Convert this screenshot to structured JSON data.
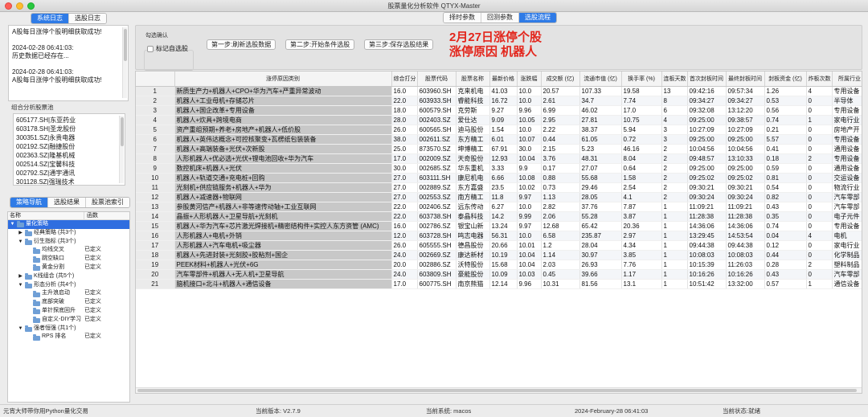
{
  "window": {
    "title": "股票量化分析软件 QTYX-Master"
  },
  "left": {
    "log_tabs": [
      "系统日志",
      "选股日志"
    ],
    "log_lines": [
      "A股每日涨停个股明细获取成功!",
      "",
      "2024-02-28 06:41:03:",
      "历史数据已经存在...",
      "",
      "2024-02-28 06:41:03:",
      "A股每日涨停个股明细获取成功!"
    ],
    "stock_pool_label": "组合分析股票池",
    "stocks": [
      "605177.SH|东亚药业",
      "603178.SH|圣龙股份",
      "300351.SZ|永贵电器",
      "002192.SZ|融捷股份",
      "002363.SZ|隆基机械",
      "002514.SZ|宝馨科技",
      "002792.SZ|通宇通讯",
      "301128.SZ|强瑞技术"
    ],
    "nav_tabs": [
      "策略导航",
      "选股结果",
      "股票池索引"
    ],
    "tree_headers": [
      "名称",
      "函数"
    ],
    "tree": [
      {
        "label": "量化策略",
        "fn": "",
        "level": 0,
        "tri": "▼",
        "folder": true,
        "sel": true
      },
      {
        "label": "经典策略 (共3个)",
        "fn": "",
        "level": 1,
        "tri": "▶",
        "folder": true
      },
      {
        "label": "衍生指标 (共3个)",
        "fn": "",
        "level": 1,
        "tri": "▼",
        "folder": true
      },
      {
        "label": "均线交叉",
        "fn": "已定义",
        "level": 2,
        "tri": "",
        "folder": true
      },
      {
        "label": "跳空缺口",
        "fn": "已定义",
        "level": 2,
        "tri": "",
        "folder": true
      },
      {
        "label": "黄金分割",
        "fn": "已定义",
        "level": 2,
        "tri": "",
        "folder": true
      },
      {
        "label": "K线组合 (共5个)",
        "fn": "",
        "level": 1,
        "tri": "▶",
        "folder": true
      },
      {
        "label": "形态分析 (共4个)",
        "fn": "",
        "level": 1,
        "tri": "▼",
        "folder": true
      },
      {
        "label": "主升浪启动",
        "fn": "已定义",
        "level": 2,
        "tri": "",
        "folder": true
      },
      {
        "label": "底部突破",
        "fn": "已定义",
        "level": 2,
        "tri": "",
        "folder": true
      },
      {
        "label": "单针探底回升",
        "fn": "已定义",
        "level": 2,
        "tri": "",
        "folder": true
      },
      {
        "label": "自定义-DIY学习",
        "fn": "已定义",
        "level": 2,
        "tri": "",
        "folder": true
      },
      {
        "label": "强者恒强 (共1个)",
        "fn": "",
        "level": 1,
        "tri": "▼",
        "folder": true
      },
      {
        "label": "RPS 排名",
        "fn": "已定义",
        "level": 2,
        "tri": "",
        "folder": true
      }
    ]
  },
  "right": {
    "tabs": [
      "择时参数",
      "回测参数",
      "选股流程"
    ],
    "group_label": "勾选确认",
    "checkbox_label": "标记自选股",
    "buttons": [
      "第一步:刷新选股数据",
      "第二步:开始条件选股",
      "第三步:保存选股结果"
    ],
    "banner_lines": [
      "2月27日涨停个股",
      "涨停原因 机器人"
    ],
    "columns": [
      "",
      "涨停原因类别",
      "综合打分",
      "股票代码",
      "股票名称",
      "最新价格",
      "涨跌幅",
      "成交额 (亿)",
      "流通市值 (亿)",
      "换手率 (%)",
      "连板天数",
      "首次封板时间",
      "最终封板时间",
      "封板资金 (亿)",
      "炸板次数",
      "所属行业"
    ],
    "rows": [
      [
        "1",
        "新质生产力+机器人+CPO+华为汽车+严重异常波动",
        "16.0",
        "603960.SH",
        "克来机电",
        "41.03",
        "10.0",
        "20.57",
        "107.33",
        "19.58",
        "13",
        "09:42:16",
        "09:57:34",
        "1.26",
        "4",
        "专用设备"
      ],
      [
        "2",
        "机器人+工业母机+存储芯片",
        "22.0",
        "603933.SH",
        "睿能科技",
        "16.72",
        "10.0",
        "2.61",
        "34.7",
        "7.74",
        "8",
        "09:34:27",
        "09:34:27",
        "0.53",
        "0",
        "半导体"
      ],
      [
        "3",
        "机器人+国企改革+专用设备",
        "18.0",
        "600579.SH",
        "克劳斯",
        "9.27",
        "9.96",
        "6.99",
        "46.02",
        "17.0",
        "6",
        "09:32:08",
        "13:12:20",
        "0.56",
        "0",
        "专用设备"
      ],
      [
        "4",
        "机器人+炊具+跨境电商",
        "28.0",
        "002403.SZ",
        "爱仕达",
        "9.09",
        "10.05",
        "2.95",
        "27.81",
        "10.75",
        "4",
        "09:25:00",
        "09:38:57",
        "0.74",
        "1",
        "家电行业"
      ],
      [
        "5",
        "资产重组预期+养老+房地产+机器人+低价股",
        "26.0",
        "600565.SH",
        "迪马股份",
        "1.54",
        "10.0",
        "2.22",
        "38.37",
        "5.94",
        "3",
        "10:27:09",
        "10:27:09",
        "0.21",
        "0",
        "房地产开"
      ],
      [
        "6",
        "机器人+英伟达概念+可控核聚变+瓦楞纸包装装备",
        "38.0",
        "002611.SZ",
        "东方精工",
        "6.01",
        "10.07",
        "0.44",
        "61.05",
        "0.72",
        "3",
        "09:25:00",
        "09:25:00",
        "5.57",
        "0",
        "专用设备"
      ],
      [
        "7",
        "机器人+高端装备+光伏+次新股",
        "25.0",
        "873570.SZ",
        "坤博精工",
        "67.91",
        "30.0",
        "2.15",
        "5.23",
        "46.16",
        "2",
        "10:04:56",
        "10:04:56",
        "0.41",
        "0",
        "通用设备"
      ],
      [
        "8",
        "人形机器人+优必选+光伏+锂电池回收+华为汽车",
        "17.0",
        "002009.SZ",
        "天奇股份",
        "12.93",
        "10.04",
        "3.76",
        "48.31",
        "8.04",
        "2",
        "09:48:57",
        "13:10:33",
        "0.18",
        "2",
        "专用设备"
      ],
      [
        "9",
        "数控机床+机器人+光伏",
        "30.0",
        "002685.SZ",
        "华东重机",
        "3.33",
        "9.9",
        "0.17",
        "27.07",
        "0.64",
        "2",
        "09:25:00",
        "09:25:00",
        "0.59",
        "0",
        "通用设备"
      ],
      [
        "10",
        "机器人+轨道交通+充电桩+回购",
        "27.0",
        "603111.SH",
        "康尼机电",
        "6.66",
        "10.08",
        "0.88",
        "55.68",
        "1.58",
        "2",
        "09:25:02",
        "09:25:02",
        "0.81",
        "0",
        "交运设备"
      ],
      [
        "11",
        "光刻机+供应链服务+机器人+华为",
        "27.0",
        "002889.SZ",
        "东方嘉盛",
        "23.5",
        "10.02",
        "0.73",
        "29.46",
        "2.54",
        "2",
        "09:30:21",
        "09:30:21",
        "0.54",
        "0",
        "物流行业"
      ],
      [
        "12",
        "机器人+减速器+物联网",
        "27.0",
        "002553.SZ",
        "南方精工",
        "11.8",
        "9.97",
        "1.13",
        "28.05",
        "4.1",
        "2",
        "09:30:24",
        "09:30:24",
        "0.82",
        "0",
        "汽车零部"
      ],
      [
        "13",
        "参股黄河信产+机器人+非等速传动轴+工业互联网",
        "22.0",
        "002406.SZ",
        "远东传动",
        "6.27",
        "10.0",
        "2.82",
        "37.76",
        "7.87",
        "1",
        "11:09:21",
        "11:09:21",
        "0.43",
        "0",
        "汽车零部"
      ],
      [
        "14",
        "晶振+人形机器人+卫星导航+光刻机",
        "22.0",
        "603738.SH",
        "泰晶科技",
        "14.2",
        "9.99",
        "2.06",
        "55.28",
        "3.87",
        "1",
        "11:28:38",
        "11:28:38",
        "0.35",
        "0",
        "电子元件"
      ],
      [
        "15",
        "机器人+华为汽车+芯片激光焊接机+精密结构件+实控人东方资管 (AMC)",
        "16.0",
        "002786.SZ",
        "银宝山新",
        "13.24",
        "9.97",
        "12.68",
        "65.42",
        "20.36",
        "1",
        "14:36:06",
        "14:36:06",
        "0.74",
        "0",
        "专用设备"
      ],
      [
        "16",
        "人形机器人+电机+外销",
        "12.0",
        "603728.SH",
        "鸣志电器",
        "56.31",
        "10.0",
        "6.58",
        "235.87",
        "2.97",
        "1",
        "13:29:45",
        "14:53:54",
        "0.04",
        "4",
        "电机"
      ],
      [
        "17",
        "人形机器人+汽车电机+吸尘器",
        "26.0",
        "605555.SH",
        "德昌股份",
        "20.66",
        "10.01",
        "1.2",
        "28.04",
        "4.34",
        "1",
        "09:44:38",
        "09:44:38",
        "0.12",
        "0",
        "家电行业"
      ],
      [
        "18",
        "机器人+先进封装+光刻胶+胶粘剂+国企",
        "24.0",
        "002669.SZ",
        "康达新材",
        "10.19",
        "10.04",
        "1.14",
        "30.97",
        "3.85",
        "1",
        "10:08:03",
        "10:08:03",
        "0.44",
        "0",
        "化学制品"
      ],
      [
        "19",
        "PEEK材料+机器人+光伏+6G",
        "20.0",
        "002886.SZ",
        "沃特股份",
        "15.68",
        "10.04",
        "2.03",
        "26.93",
        "7.76",
        "1",
        "10:15:39",
        "11:26:03",
        "0.28",
        "2",
        "塑料制品"
      ],
      [
        "20",
        "汽车零部件+机器人+无人机+卫星导航",
        "24.0",
        "603809.SH",
        "豪能股份",
        "10.09",
        "10.03",
        "0.45",
        "39.66",
        "1.17",
        "1",
        "10:16:26",
        "10:16:26",
        "0.43",
        "0",
        "汽车零部"
      ],
      [
        "21",
        "脑机接口+北斗+机器人+通信设备",
        "17.0",
        "600775.SH",
        "南京熊猫",
        "12.14",
        "9.96",
        "10.31",
        "81.56",
        "13.1",
        "1",
        "10:51:42",
        "13:32:00",
        "0.57",
        "1",
        "通信设备"
      ]
    ]
  },
  "status": {
    "left": "元宵大师带你用Python量化交易",
    "version": "当前版本:  V2.7.9",
    "system": "当前系统:  macos",
    "time": "2024-February-28 06:41:03",
    "state": "当前状态:就绪"
  }
}
